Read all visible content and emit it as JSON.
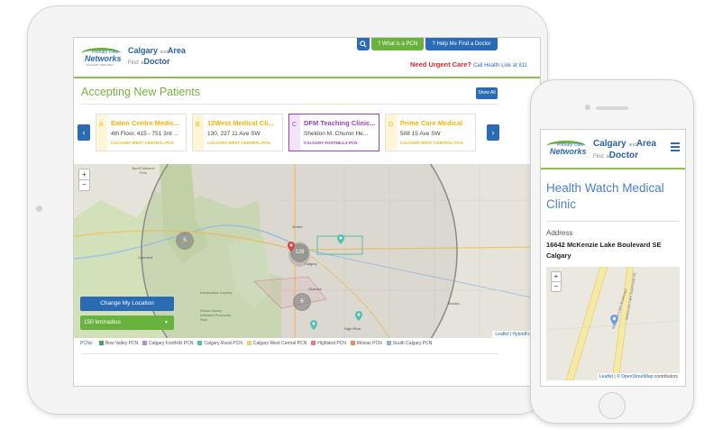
{
  "tablet": {
    "header": {
      "brand_line1": "Calgary",
      "brand_and": "and",
      "brand_area": "Area",
      "brand_find": "Find",
      "brand_a": "a",
      "brand_doctor": "Doctor",
      "logo_top": "Primary Care",
      "logo_main": "Networks",
      "logo_sub": "CALGARY AND AREA",
      "what_is_pcn": "What is a PCN",
      "help_me": "Help Me Find a Doctor",
      "urgent_label": "Need Urgent Care?",
      "urgent_link": "Call Health Link at 811"
    },
    "accepting_title": "Accepting New Patients",
    "show_all": "Show All",
    "prev": "‹",
    "next": "›",
    "cards": [
      {
        "letter": "A",
        "name": "Eaton Centre Medic...",
        "address": "4th Floor, 415 - 751 3rd ...",
        "pcn": "CALGARY WEST CENTRAL PCN",
        "color": "#f0b400",
        "band": "#fff6d8"
      },
      {
        "letter": "B",
        "name": "12West Medical Cli...",
        "address": "130, 227 11 Ave SW",
        "pcn": "CALGARY WEST CENTRAL PCN",
        "color": "#f0b400",
        "band": "#fff6d8"
      },
      {
        "letter": "C",
        "name": "DFM Teaching Clinic...",
        "address": "Sheldon M. Chumir He...",
        "pcn": "CALGARY FOOTHILLS PCN",
        "color": "#9b3fc7",
        "band": "#f2e4fa"
      },
      {
        "letter": "D",
        "name": "Prime Care Medical",
        "address": "508 15 Ave SW",
        "pcn": "CALGARY WEST CENTRAL PCN",
        "color": "#f0b400",
        "band": "#fff6d8"
      }
    ],
    "map": {
      "zoom_in": "+",
      "zoom_out": "−",
      "clusters": [
        "5",
        "129",
        "6"
      ],
      "place_labels": [
        "Banff National Park",
        "Canmore",
        "Airdrie",
        "Calgary",
        "Okotoks",
        "High River",
        "Kananaskis Country",
        "Elbow-Sheep Wildland Provincial Park",
        "Brooks"
      ],
      "change_location": "Change My Location",
      "radius": "150 km/radius",
      "attribution_leaflet": "Leaflet",
      "attribution_rest": "HybridForge"
    },
    "legend": {
      "label": "PCNs:",
      "items": [
        {
          "name": "Bow Valley PCN",
          "color": "#4aa35a"
        },
        {
          "name": "Calgary Foothills PCN",
          "color": "#b98be0"
        },
        {
          "name": "Calgary Rural PCN",
          "color": "#4fc1b0"
        },
        {
          "name": "Calgary West Central PCN",
          "color": "#f3d36b"
        },
        {
          "name": "Highland PCN",
          "color": "#e9788f"
        },
        {
          "name": "Mosiac PCN",
          "color": "#ef8a5a"
        },
        {
          "name": "South Calgary PCN",
          "color": "#8fb3e0"
        }
      ]
    }
  },
  "phone": {
    "header": {
      "brand_line1": "Calgary",
      "brand_and": "and",
      "brand_area": "Area",
      "brand_find": "Find",
      "brand_a": "a",
      "brand_doctor": "Doctor",
      "logo_top": "Primary Care",
      "logo_main": "Networks"
    },
    "clinic_title": "Health Watch Medical Clinic",
    "address_label": "Address",
    "address_line1": "16642 McKenzie Lake Boulevard SE",
    "address_line2": "Calgary",
    "map": {
      "zoom_in": "+",
      "zoom_out": "−",
      "road1": "McKenzie Lake Boulevard",
      "road2": "McKenzie Lake Boulevard SE",
      "attribution_leaflet": "Leaflet",
      "attribution_osm": "© OpenStreetMap",
      "attribution_rest": "contributors"
    }
  }
}
